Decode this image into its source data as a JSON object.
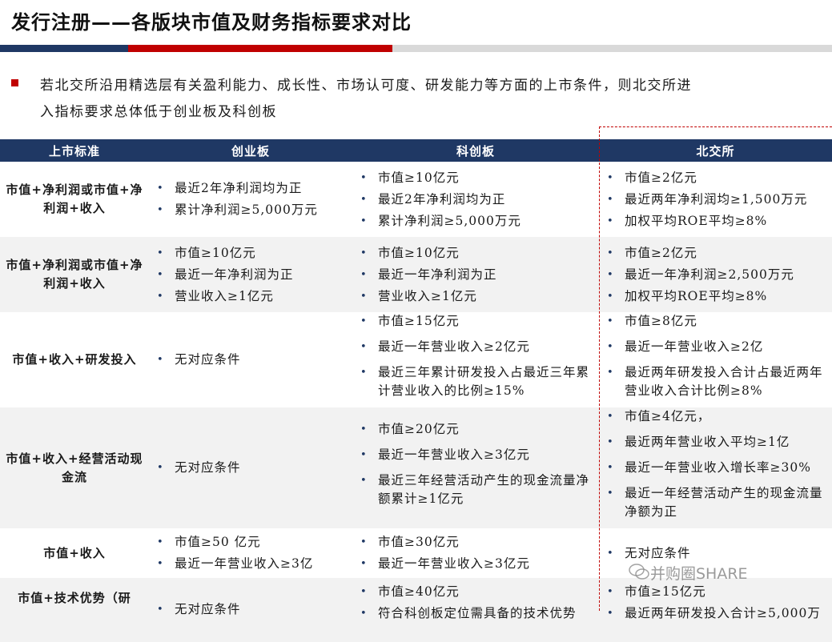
{
  "title": "发行注册——各版块市值及财务指标要求对比",
  "intro": {
    "line1": "若北交所沿用精选层有关盈利能力、成长性、市场认可度、研发能力等方面的上市条件，则北交所进",
    "line2": "入指标要求总体低于创业板及科创板"
  },
  "colors": {
    "header_bg": "#1f3864",
    "accent_red": "#c00000",
    "row_alt": "#f2f2f2"
  },
  "table": {
    "headers": [
      "上市标准",
      "创业板",
      "科创板",
      "北交所"
    ],
    "rows": [
      {
        "standard": "市值+净利润或市值+净利润+收入",
        "chinext": [
          "最近2年净利润均为正",
          "累计净利润≥5,000万元"
        ],
        "star": [
          "市值≥10亿元",
          "最近2年净利润均为正",
          "累计净利润≥5,000万元"
        ],
        "bse": [
          "市值≥2亿元",
          "最近两年净利润均≥1,500万元",
          "加权平均ROE平均≥8%"
        ]
      },
      {
        "standard": "市值+净利润或市值+净利润+收入",
        "chinext": [
          "市值≥10亿元",
          "最近一年净利润为正",
          "营业收入≥1亿元"
        ],
        "star": [
          "市值≥10亿元",
          "最近一年净利润为正",
          "营业收入≥1亿元"
        ],
        "bse": [
          "市值≥2亿元",
          "最近一年净利润≥2,500万元",
          "加权平均ROE平均≥8%"
        ]
      },
      {
        "standard": "市值+收入+研发投入",
        "chinext": [
          "无对应条件"
        ],
        "star": [
          "市值≥15亿元",
          "最近一年营业收入≥2亿元",
          "最近三年累计研发投入占最近三年累计营业收入的比例≥15%"
        ],
        "bse": [
          "市值≥8亿元",
          "最近一年营业收入≥2亿",
          "最近两年研发投入合计占最近两年营业收入合计比例≥8%"
        ]
      },
      {
        "standard": "市值+收入+经营活动现金流",
        "chinext": [
          "无对应条件"
        ],
        "star": [
          "市值≥20亿元",
          "最近一年营业收入≥3亿元",
          "最近三年经营活动产生的现金流量净额累计≥1亿元"
        ],
        "bse": [
          "市值≥4亿元，",
          "最近两年营业收入平均≥1亿",
          "最近一年营业收入增长率≥30%",
          "最近一年经营活动产生的现金流量净额为正"
        ]
      },
      {
        "standard": "市值+收入",
        "chinext": [
          "市值≥50 亿元",
          "最近一年营业收入≥3亿"
        ],
        "star": [
          "市值≥30亿元",
          "最近一年营业收入≥3亿元"
        ],
        "bse": [
          "无对应条件"
        ]
      },
      {
        "standard": "市值+技术优势（研",
        "chinext": [
          "无对应条件"
        ],
        "star": [
          "市值≥40亿元",
          "符合科创板定位需具备的技术优势"
        ],
        "bse": [
          "市值≥15亿元",
          "最近两年研发投入合计≥5,000万"
        ]
      }
    ]
  },
  "watermark": "并购圈SHARE"
}
